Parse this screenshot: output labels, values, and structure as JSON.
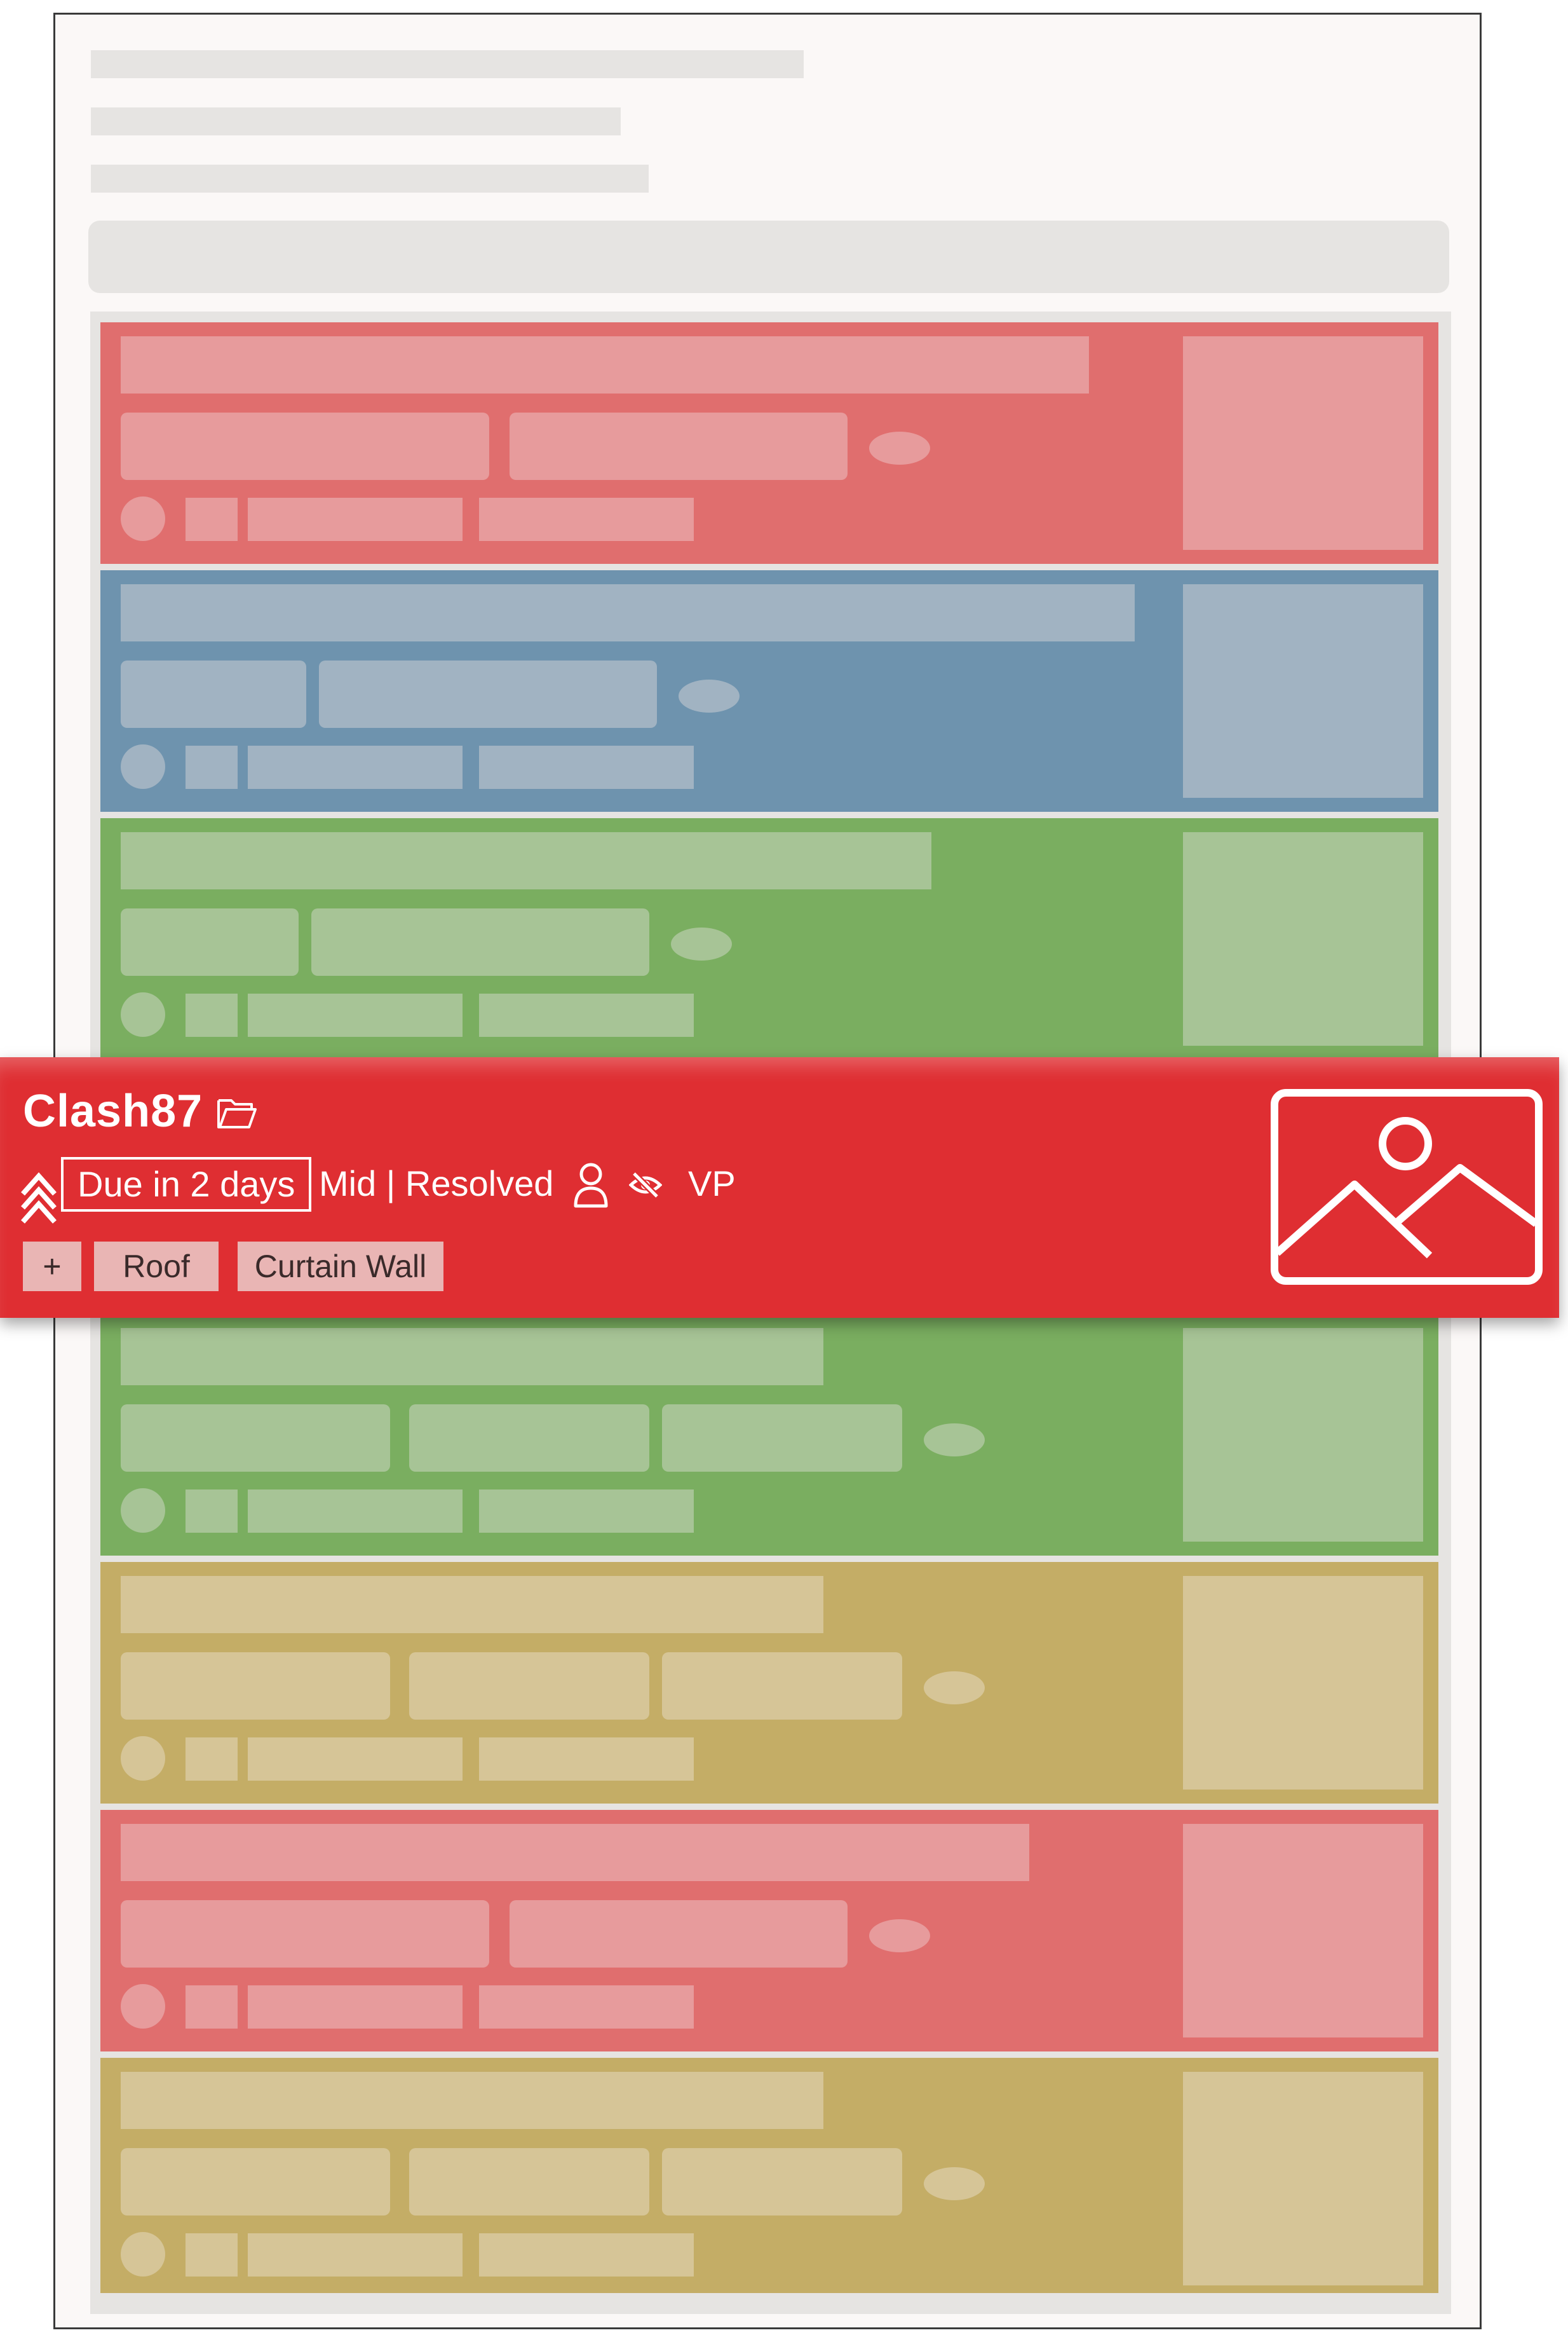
{
  "colors": {
    "red_card": "#e06e6e",
    "red_placeholder": "#e79b9c",
    "blue_card": "#6e93ae",
    "blue_placeholder": "#a1b3c2",
    "green_card": "#7aae60",
    "green_placeholder": "#a7c496",
    "yellow_card": "#c4ad66",
    "yellow_placeholder": "#d6c597",
    "highlight_background": "#df2e32",
    "tag_background": "#e9b5b4",
    "skeleton_gray": "#e6e4e2"
  },
  "card_list": {
    "cards": [
      {
        "color": "red"
      },
      {
        "color": "blue"
      },
      {
        "color": "green"
      },
      {
        "color": "green"
      },
      {
        "color": "green"
      },
      {
        "color": "yellow"
      },
      {
        "color": "red"
      },
      {
        "color": "yellow"
      }
    ]
  },
  "highlighted_card": {
    "title": "Clash87",
    "title_icon": "folder-icon",
    "priority_icon": "double-chevron-up-icon",
    "due_label": "Due in 2 days",
    "status_text": "Mid | Resolved",
    "assignee_icon": "user-icon",
    "visibility_icon": "eye-off-icon",
    "viewpoint_label": "VP",
    "add_tag_label": "+",
    "tags": [
      "Roof",
      "Curtain Wall"
    ],
    "thumbnail_icon": "image-placeholder-icon"
  }
}
